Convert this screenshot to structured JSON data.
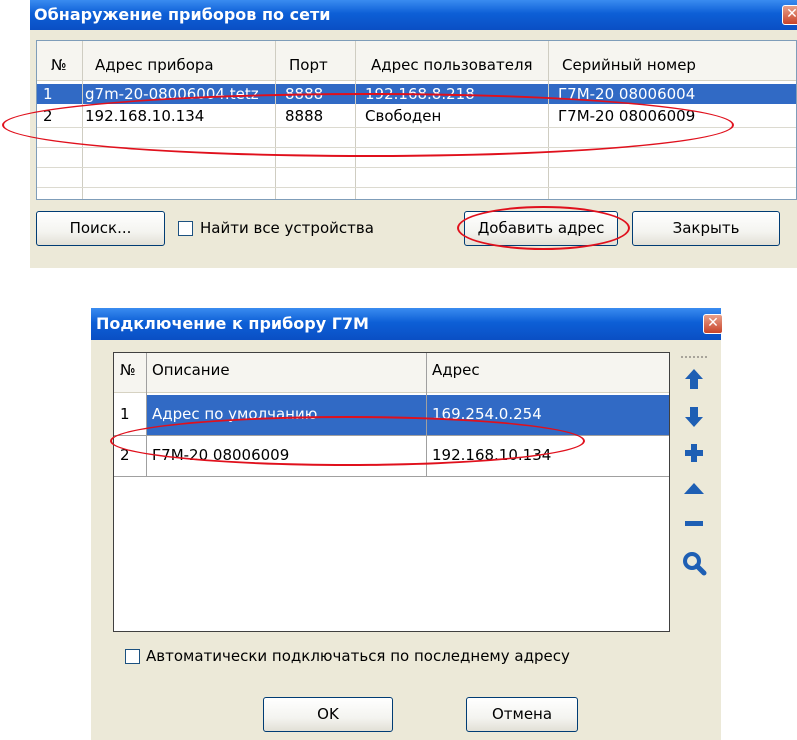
{
  "discovery": {
    "title": "Обнаружение приборов по сети",
    "close_glyph": "✕",
    "columns": [
      "№",
      "Адрес прибора",
      "Порт",
      "Адрес пользователя",
      "Серийный номер"
    ],
    "rows": [
      {
        "num": "1",
        "address": "g7m-20-08006004.tetz",
        "port": "8888",
        "user": "192.168.8.218",
        "serial": "Г7М-20 08006004"
      },
      {
        "num": "2",
        "address": "192.168.10.134",
        "port": "8888",
        "user": "Свободен",
        "serial": "Г7М-20 08006009"
      }
    ],
    "search_label": "Поиск...",
    "find_all_label": "Найти все устройства",
    "add_label": "Добавить адрес",
    "close_label": "Закрыть"
  },
  "connect": {
    "title": "Подключение к прибору Г7М",
    "close_glyph": "✕",
    "columns": [
      "№",
      "Описание",
      "Адрес"
    ],
    "rows": [
      {
        "num": "1",
        "desc": "Адрес по умолчанию",
        "addr": "169.254.0.254"
      },
      {
        "num": "2",
        "desc": "Г7М-20 08006009",
        "addr": "192.168.10.134"
      }
    ],
    "auto_connect_label": "Автоматически подключаться по последнему адресу",
    "ok_label": "OK",
    "cancel_label": "Отмена",
    "toolbar_icons": [
      "arrow-up-icon",
      "arrow-down-icon",
      "plus-icon",
      "triangle-up-icon",
      "minus-icon",
      "magnifier-icon"
    ]
  },
  "colors": {
    "title_bar": "#0a4fc4",
    "selection": "#316ac5",
    "annotation": "#e0101c",
    "icon_blue": "#1e5fb4"
  }
}
